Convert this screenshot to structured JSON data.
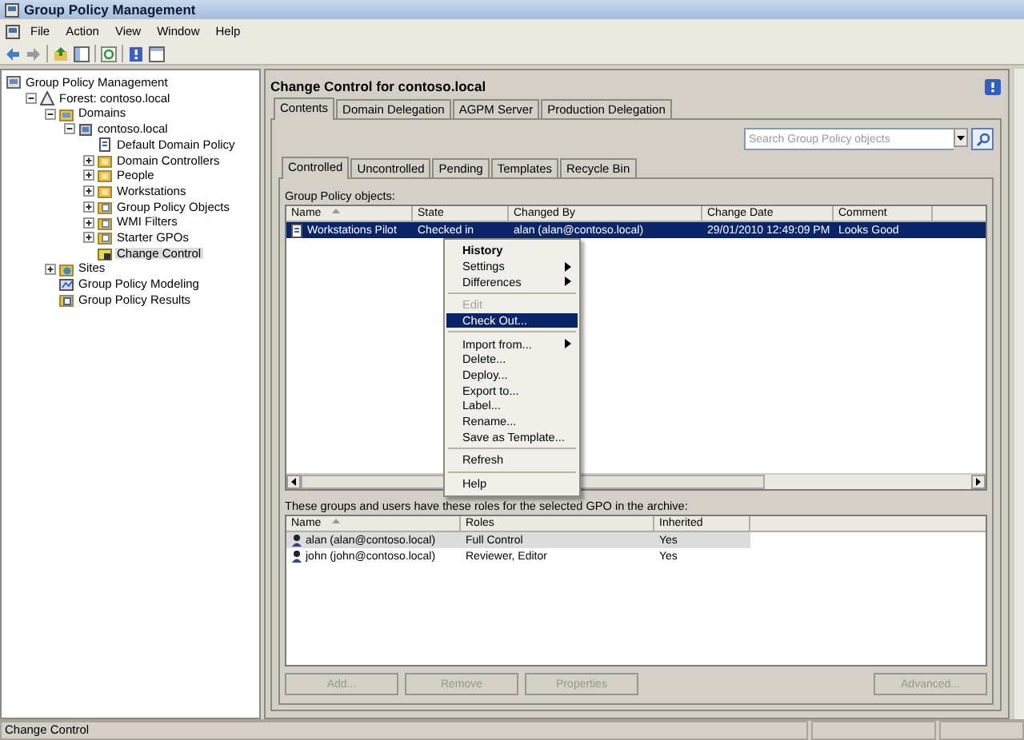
{
  "window": {
    "title": "Group Policy Management"
  },
  "menu_bar": [
    "File",
    "Action",
    "View",
    "Window",
    "Help"
  ],
  "tree": [
    {
      "label": "Group Policy Management",
      "kind": "root",
      "selected": false,
      "children": [
        {
          "label": "Forest: contoso.local",
          "kind": "forest",
          "expanded": true,
          "selected": false,
          "children": [
            {
              "label": "Domains",
              "kind": "domains",
              "expanded": true,
              "selected": false,
              "children": [
                {
                  "label": "contoso.local",
                  "kind": "domain",
                  "expanded": true,
                  "selected": false,
                  "children": [
                    {
                      "label": "Default Domain Policy",
                      "kind": "gpo",
                      "selected": false
                    },
                    {
                      "label": "Domain Controllers",
                      "kind": "ou",
                      "expanded": false,
                      "selected": false
                    },
                    {
                      "label": "People",
                      "kind": "ou",
                      "expanded": false,
                      "selected": false
                    },
                    {
                      "label": "Workstations",
                      "kind": "ou",
                      "expanded": false,
                      "selected": false
                    },
                    {
                      "label": "Group Policy Objects",
                      "kind": "folder",
                      "expanded": false,
                      "selected": false
                    },
                    {
                      "label": "WMI Filters",
                      "kind": "folder",
                      "expanded": false,
                      "selected": false
                    },
                    {
                      "label": "Starter GPOs",
                      "kind": "folder",
                      "expanded": false,
                      "selected": false
                    },
                    {
                      "label": "Change Control",
                      "kind": "change",
                      "selected": true
                    }
                  ]
                }
              ]
            },
            {
              "label": "Sites",
              "kind": "sites",
              "expanded": false,
              "selected": false
            },
            {
              "label": "Group Policy Modeling",
              "kind": "modeling",
              "selected": false
            },
            {
              "label": "Group Policy Results",
              "kind": "results",
              "selected": false
            }
          ]
        }
      ]
    }
  ],
  "pane": {
    "title": "Change Control for contoso.local",
    "tabs": [
      {
        "label": "Contents",
        "selected": true
      },
      {
        "label": "Domain Delegation",
        "selected": false
      },
      {
        "label": "AGPM Server",
        "selected": false
      },
      {
        "label": "Production Delegation",
        "selected": false
      }
    ],
    "search": {
      "placeholder": "Search Group Policy objects"
    },
    "subtabs": [
      {
        "label": "Controlled",
        "selected": true
      },
      {
        "label": "Uncontrolled",
        "selected": false
      },
      {
        "label": "Pending",
        "selected": false
      },
      {
        "label": "Templates",
        "selected": false
      },
      {
        "label": "Recycle Bin",
        "selected": false
      }
    ],
    "gpo_label": "Group Policy objects:",
    "gpo_table": {
      "columns": [
        "Name",
        "State",
        "Changed By",
        "Change Date",
        "Comment"
      ],
      "rows": [
        {
          "cells": [
            "Workstations Pilot",
            "Checked in",
            "alan (alan@contoso.local)",
            "29/01/2010 12:49:09 PM",
            "Looks Good"
          ],
          "selected": true
        }
      ]
    },
    "roles_label": "These groups and users have these roles for the selected GPO in the archive:",
    "roles_table": {
      "columns": [
        "Name",
        "Roles",
        "Inherited"
      ],
      "rows": [
        {
          "cells": [
            "alan (alan@contoso.local)",
            "Full Control",
            "Yes"
          ],
          "selected": true
        },
        {
          "cells": [
            "john (john@contoso.local)",
            "Reviewer, Editor",
            "Yes"
          ],
          "selected": false
        }
      ]
    },
    "buttons": [
      {
        "label": "Add...",
        "disabled": true
      },
      {
        "label": "Remove",
        "disabled": true
      },
      {
        "label": "Properties",
        "disabled": true
      },
      {
        "label": "Advanced...",
        "disabled": true
      }
    ]
  },
  "context_menu": [
    {
      "kind": "item",
      "label": "History",
      "bold": true
    },
    {
      "kind": "item",
      "label": "Settings",
      "submenu": true
    },
    {
      "kind": "item",
      "label": "Differences",
      "submenu": true
    },
    {
      "kind": "separator"
    },
    {
      "kind": "item",
      "label": "Edit",
      "disabled": true
    },
    {
      "kind": "item",
      "label": "Check Out...",
      "highlighted": true
    },
    {
      "kind": "separator"
    },
    {
      "kind": "item",
      "label": "Import from...",
      "submenu": true
    },
    {
      "kind": "item",
      "label": "Delete..."
    },
    {
      "kind": "item",
      "label": "Deploy..."
    },
    {
      "kind": "item",
      "label": "Export to..."
    },
    {
      "kind": "item",
      "label": "Label..."
    },
    {
      "kind": "item",
      "label": "Rename..."
    },
    {
      "kind": "item",
      "label": "Save as Template..."
    },
    {
      "kind": "separator"
    },
    {
      "kind": "item",
      "label": "Refresh"
    },
    {
      "kind": "separator"
    },
    {
      "kind": "item",
      "label": "Help"
    }
  ],
  "status_bar": {
    "text": "Change Control"
  }
}
